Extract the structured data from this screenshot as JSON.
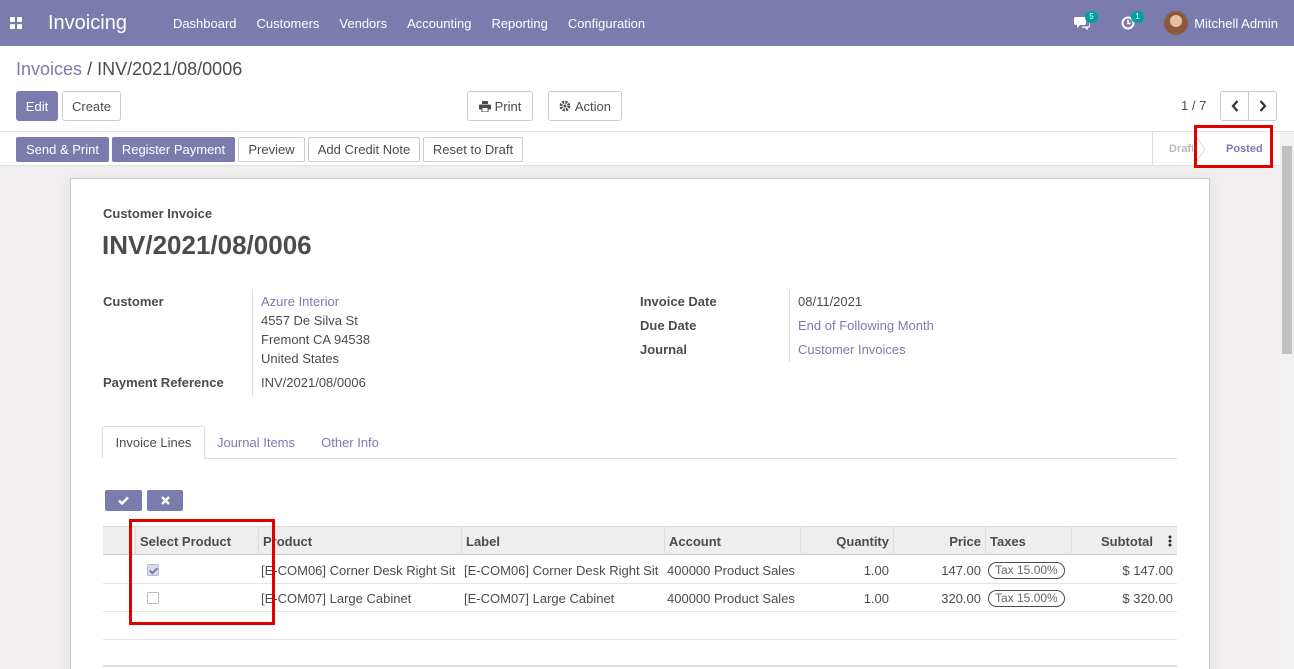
{
  "app": {
    "brand": "Invoicing"
  },
  "nav": {
    "menu": [
      "Dashboard",
      "Customers",
      "Vendors",
      "Accounting",
      "Reporting",
      "Configuration"
    ],
    "messages_count": "5",
    "activities_count": "1",
    "user_name": "Mitchell Admin"
  },
  "breadcrumb": {
    "parent": "Invoices",
    "separator": "/",
    "current": "INV/2021/08/0006"
  },
  "control": {
    "edit": "Edit",
    "create": "Create",
    "print": "Print",
    "action": "Action",
    "pager": "1 / 7"
  },
  "statusbar": {
    "buttons": [
      "Send & Print",
      "Register Payment",
      "Preview",
      "Add Credit Note",
      "Reset to Draft"
    ],
    "stages": [
      "Draft",
      "Posted"
    ],
    "current_stage": "Posted"
  },
  "invoice": {
    "type": "Customer Invoice",
    "number": "INV/2021/08/0006",
    "customer_label": "Customer",
    "customer_name": "Azure Interior",
    "address": [
      "4557 De Silva St",
      "Fremont CA 94538",
      "United States"
    ],
    "payment_ref_label": "Payment Reference",
    "payment_ref": "INV/2021/08/0006",
    "invoice_date_label": "Invoice Date",
    "invoice_date": "08/11/2021",
    "due_date_label": "Due Date",
    "due_date": "End of Following Month",
    "journal_label": "Journal",
    "journal": "Customer Invoices"
  },
  "tabs": [
    "Invoice Lines",
    "Journal Items",
    "Other Info"
  ],
  "lines": {
    "headers": [
      "Select Product",
      "Product",
      "Label",
      "Account",
      "Quantity",
      "Price",
      "Taxes",
      "Subtotal"
    ],
    "rows": [
      {
        "selected": true,
        "product": "[E-COM06] Corner Desk Right Sit",
        "label": "[E-COM06] Corner Desk Right Sit",
        "account": "400000 Product Sales",
        "quantity": "1.00",
        "price": "147.00",
        "tax": "Tax 15.00%",
        "subtotal": "$ 147.00"
      },
      {
        "selected": false,
        "product": "[E-COM07] Large Cabinet",
        "label": "[E-COM07] Large Cabinet",
        "account": "400000 Product Sales",
        "quantity": "1.00",
        "price": "320.00",
        "tax": "Tax 15.00%",
        "subtotal": "$ 320.00"
      }
    ]
  },
  "colors": {
    "brand": "#7c7bad",
    "highlight": "#e00000"
  },
  "icons": [
    "apps-icon",
    "chat-icon",
    "clock-icon",
    "printer-icon",
    "gear-icon",
    "chevron-left-icon",
    "chevron-right-icon",
    "check-icon",
    "close-icon",
    "column-options-icon"
  ]
}
